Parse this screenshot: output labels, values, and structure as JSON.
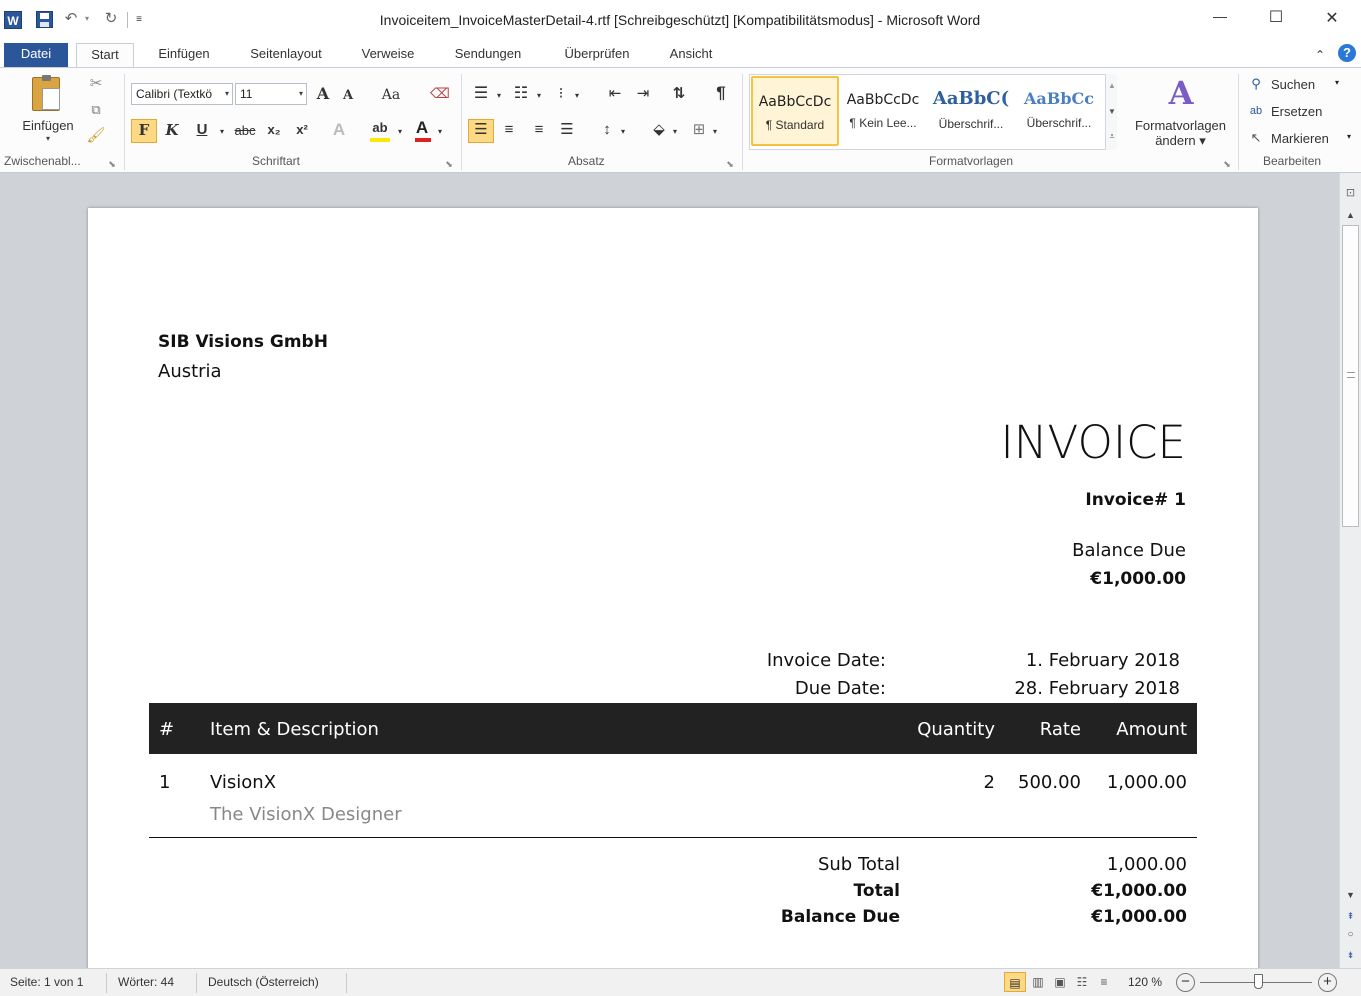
{
  "titlebar": {
    "title": "Invoiceitem_InvoiceMasterDetail-4.rtf [Schreibgeschützt] [Kompatibilitätsmodus]  -  Microsoft Word",
    "word_logo": "W",
    "minimize": "—",
    "maximize": "☐",
    "close": "✕"
  },
  "tabs": {
    "file": "Datei",
    "items": [
      "Start",
      "Einfügen",
      "Seitenlayout",
      "Verweise",
      "Sendungen",
      "Überprüfen",
      "Ansicht"
    ]
  },
  "ribbon": {
    "clipboard": {
      "paste": "Einfügen",
      "label": "Zwischenabl..."
    },
    "font": {
      "font_name": "Calibri (Textkö",
      "font_size": "11",
      "bold": "F",
      "italic": "K",
      "underline": "U",
      "strike": "abc",
      "sub": "x₂",
      "sup": "x²",
      "grow": "A",
      "shrink": "A",
      "case": "Aa",
      "color_a": "A",
      "label": "Schriftart"
    },
    "paragraph": {
      "label": "Absatz",
      "pilcrow": "¶"
    },
    "styles": {
      "items": [
        {
          "preview": "AaBbCcDc",
          "name": "¶ Standard"
        },
        {
          "preview": "AaBbCcDc",
          "name": "¶ Kein Lee..."
        },
        {
          "preview": "AaBbC(",
          "name": "Überschrif..."
        },
        {
          "preview": "AaBbCc",
          "name": "Überschrif..."
        }
      ],
      "change_line1": "Formatvorlagen",
      "change_line2": "ändern",
      "label": "Formatvorlagen"
    },
    "editing": {
      "find": "Suchen",
      "replace": "Ersetzen",
      "select": "Markieren",
      "label": "Bearbeiten"
    }
  },
  "document": {
    "company": "SIB Visions GmbH",
    "country": "Austria",
    "heading": "INVOICE",
    "invoice_no": "Invoice# 1",
    "balance_label": "Balance Due",
    "balance_value": "€1,000.00",
    "invoice_date_label": "Invoice Date:",
    "invoice_date": "1. February 2018",
    "due_date_label": "Due Date:",
    "due_date": "28. February 2018",
    "table_headers": {
      "num": "#",
      "item": "Item & Description",
      "qty": "Quantity",
      "rate": "Rate",
      "amount": "Amount"
    },
    "rows": [
      {
        "num": "1",
        "item": "VisionX",
        "desc": "The VisionX Designer",
        "qty": "2",
        "rate": "500.00",
        "amount": "1,000.00"
      }
    ],
    "subtotal_label": "Sub Total",
    "subtotal_value": "1,000.00",
    "total_label": "Total",
    "total_value": "€1,000.00",
    "balance_due_label": "Balance Due",
    "balance_due_value": "€1,000.00"
  },
  "statusbar": {
    "page": "Seite: 1 von 1",
    "words": "Wörter: 44",
    "language": "Deutsch (Österreich)",
    "zoom": "120 %",
    "zoom_minus": "−",
    "zoom_plus": "+"
  },
  "zoom_slider_fraction": 0.52,
  "colors": {
    "file_tab": "#2b579a",
    "table_header_bg": "#222222",
    "workspace_bg": "#cfd2d6",
    "style_highlight": "#f5c342"
  }
}
